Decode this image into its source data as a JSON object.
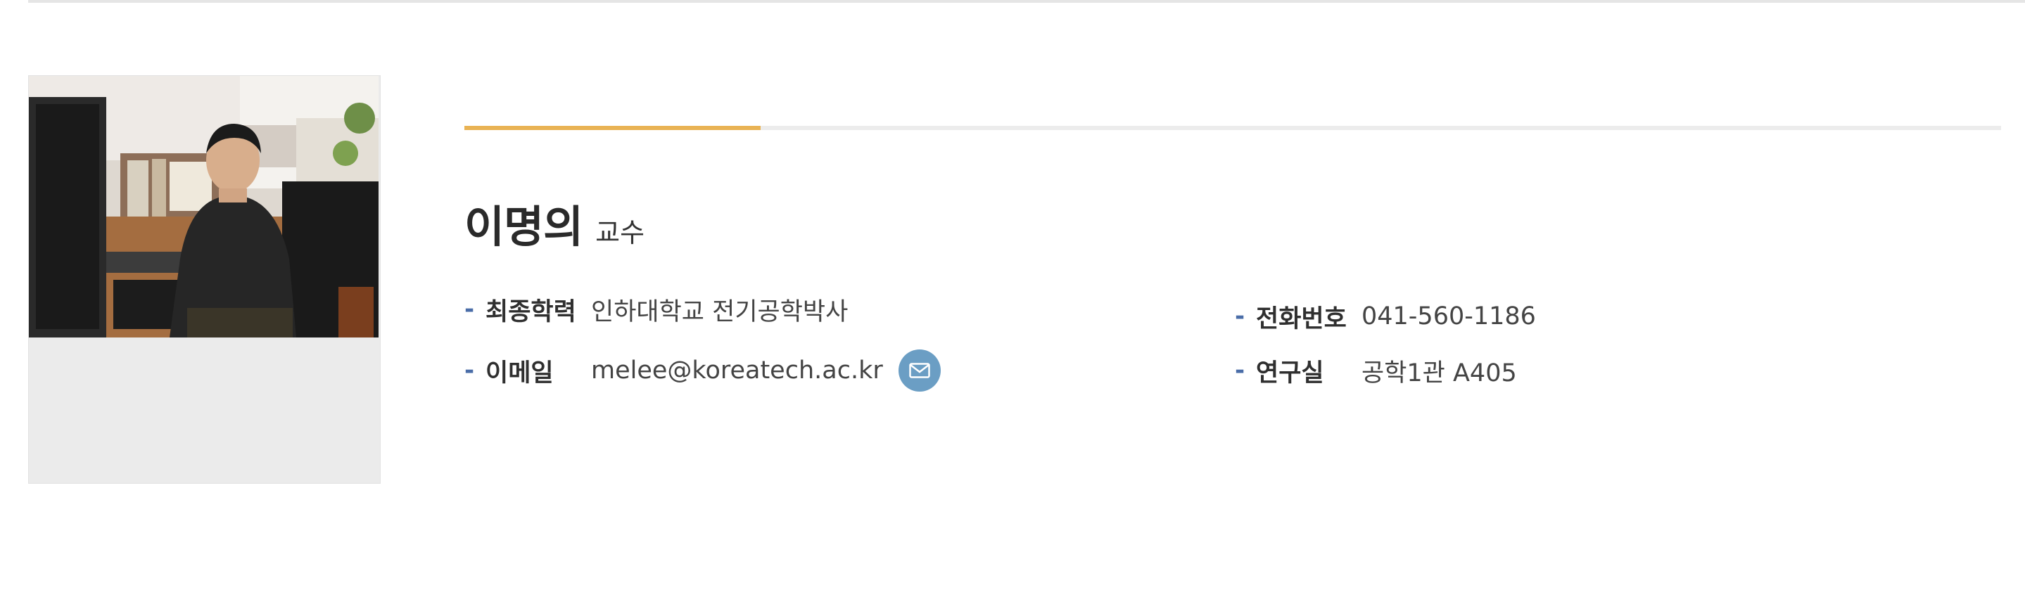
{
  "profile": {
    "name": "이명의",
    "position": "교수",
    "fields": {
      "education": {
        "label": "최종학력",
        "value": "인하대학교 전기공학박사"
      },
      "email": {
        "label": "이메일",
        "value": "melee@koreatech.ac.kr"
      },
      "phone": {
        "label": "전화번호",
        "value": "041-560-1186"
      },
      "office": {
        "label": "연구실",
        "value": "공학1관 A405"
      }
    }
  },
  "icons": {
    "mail": "envelope-icon"
  },
  "colors": {
    "accent": "#e9b354",
    "dash": "#4a6da8",
    "mail_button": "#6b9ec4"
  }
}
